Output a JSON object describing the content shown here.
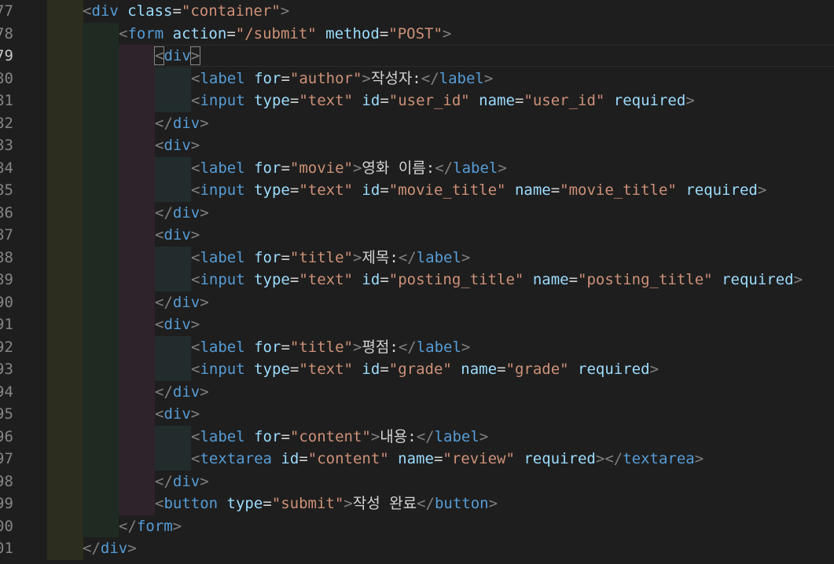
{
  "editor": {
    "language": "html",
    "active_line": "79",
    "colors": {
      "background": "#1e1e1e",
      "tag": "#569cd6",
      "attribute": "#9cdcfe",
      "string": "#ce9178",
      "text": "#d4d4d4",
      "punctuation": "#808080",
      "line_number": "#858585"
    },
    "lines": [
      {
        "num": "77",
        "indent": 0,
        "tokens": [
          [
            "p",
            "<"
          ],
          [
            "tag",
            "div"
          ],
          [
            "t",
            " "
          ],
          [
            "attr",
            "class"
          ],
          [
            "eq",
            "="
          ],
          [
            "str",
            "\"container\""
          ],
          [
            "p",
            ">"
          ]
        ]
      },
      {
        "num": "78",
        "indent": 1,
        "tokens": [
          [
            "p",
            "<"
          ],
          [
            "tag",
            "form"
          ],
          [
            "t",
            " "
          ],
          [
            "attr",
            "action"
          ],
          [
            "eq",
            "="
          ],
          [
            "str",
            "\"/submit\""
          ],
          [
            "t",
            " "
          ],
          [
            "attr",
            "method"
          ],
          [
            "eq",
            "="
          ],
          [
            "str",
            "\"POST\""
          ],
          [
            "p",
            ">"
          ]
        ]
      },
      {
        "num": "79",
        "indent": 2,
        "tokens": [
          [
            "pb",
            "<"
          ],
          [
            "tag",
            "div"
          ],
          [
            "pb",
            ">"
          ]
        ]
      },
      {
        "num": "80",
        "indent": 3,
        "tokens": [
          [
            "p",
            "<"
          ],
          [
            "tag",
            "label"
          ],
          [
            "t",
            " "
          ],
          [
            "attr",
            "for"
          ],
          [
            "eq",
            "="
          ],
          [
            "str",
            "\"author\""
          ],
          [
            "p",
            ">"
          ],
          [
            "t",
            "작성자:"
          ],
          [
            "p",
            "</"
          ],
          [
            "tag",
            "label"
          ],
          [
            "p",
            ">"
          ]
        ]
      },
      {
        "num": "81",
        "indent": 3,
        "tokens": [
          [
            "p",
            "<"
          ],
          [
            "tag",
            "input"
          ],
          [
            "t",
            " "
          ],
          [
            "attr",
            "type"
          ],
          [
            "eq",
            "="
          ],
          [
            "str",
            "\"text\""
          ],
          [
            "t",
            " "
          ],
          [
            "attr",
            "id"
          ],
          [
            "eq",
            "="
          ],
          [
            "str",
            "\"user_id\""
          ],
          [
            "t",
            " "
          ],
          [
            "attr",
            "name"
          ],
          [
            "eq",
            "="
          ],
          [
            "str",
            "\"user_id\""
          ],
          [
            "t",
            " "
          ],
          [
            "attr",
            "required"
          ],
          [
            "p",
            ">"
          ]
        ]
      },
      {
        "num": "82",
        "indent": 2,
        "tokens": [
          [
            "p",
            "</"
          ],
          [
            "tag",
            "div"
          ],
          [
            "p",
            ">"
          ]
        ]
      },
      {
        "num": "83",
        "indent": 2,
        "tokens": [
          [
            "p",
            "<"
          ],
          [
            "tag",
            "div"
          ],
          [
            "p",
            ">"
          ]
        ]
      },
      {
        "num": "84",
        "indent": 3,
        "tokens": [
          [
            "p",
            "<"
          ],
          [
            "tag",
            "label"
          ],
          [
            "t",
            " "
          ],
          [
            "attr",
            "for"
          ],
          [
            "eq",
            "="
          ],
          [
            "str",
            "\"movie\""
          ],
          [
            "p",
            ">"
          ],
          [
            "t",
            "영화 이름:"
          ],
          [
            "p",
            "</"
          ],
          [
            "tag",
            "label"
          ],
          [
            "p",
            ">"
          ]
        ]
      },
      {
        "num": "85",
        "indent": 3,
        "tokens": [
          [
            "p",
            "<"
          ],
          [
            "tag",
            "input"
          ],
          [
            "t",
            " "
          ],
          [
            "attr",
            "type"
          ],
          [
            "eq",
            "="
          ],
          [
            "str",
            "\"text\""
          ],
          [
            "t",
            " "
          ],
          [
            "attr",
            "id"
          ],
          [
            "eq",
            "="
          ],
          [
            "str",
            "\"movie_title\""
          ],
          [
            "t",
            " "
          ],
          [
            "attr",
            "name"
          ],
          [
            "eq",
            "="
          ],
          [
            "str",
            "\"movie_title\""
          ],
          [
            "t",
            " "
          ],
          [
            "attr",
            "required"
          ],
          [
            "p",
            ">"
          ]
        ]
      },
      {
        "num": "86",
        "indent": 2,
        "tokens": [
          [
            "p",
            "</"
          ],
          [
            "tag",
            "div"
          ],
          [
            "p",
            ">"
          ]
        ]
      },
      {
        "num": "87",
        "indent": 2,
        "tokens": [
          [
            "p",
            "<"
          ],
          [
            "tag",
            "div"
          ],
          [
            "p",
            ">"
          ]
        ]
      },
      {
        "num": "88",
        "indent": 3,
        "tokens": [
          [
            "p",
            "<"
          ],
          [
            "tag",
            "label"
          ],
          [
            "t",
            " "
          ],
          [
            "attr",
            "for"
          ],
          [
            "eq",
            "="
          ],
          [
            "str",
            "\"title\""
          ],
          [
            "p",
            ">"
          ],
          [
            "t",
            "제목:"
          ],
          [
            "p",
            "</"
          ],
          [
            "tag",
            "label"
          ],
          [
            "p",
            ">"
          ]
        ]
      },
      {
        "num": "89",
        "indent": 3,
        "tokens": [
          [
            "p",
            "<"
          ],
          [
            "tag",
            "input"
          ],
          [
            "t",
            " "
          ],
          [
            "attr",
            "type"
          ],
          [
            "eq",
            "="
          ],
          [
            "str",
            "\"text\""
          ],
          [
            "t",
            " "
          ],
          [
            "attr",
            "id"
          ],
          [
            "eq",
            "="
          ],
          [
            "str",
            "\"posting_title\""
          ],
          [
            "t",
            " "
          ],
          [
            "attr",
            "name"
          ],
          [
            "eq",
            "="
          ],
          [
            "str",
            "\"posting_title\""
          ],
          [
            "t",
            " "
          ],
          [
            "attr",
            "required"
          ],
          [
            "p",
            ">"
          ]
        ]
      },
      {
        "num": "90",
        "indent": 2,
        "tokens": [
          [
            "p",
            "</"
          ],
          [
            "tag",
            "div"
          ],
          [
            "p",
            ">"
          ]
        ]
      },
      {
        "num": "91",
        "indent": 2,
        "tokens": [
          [
            "p",
            "<"
          ],
          [
            "tag",
            "div"
          ],
          [
            "p",
            ">"
          ]
        ]
      },
      {
        "num": "92",
        "indent": 3,
        "tokens": [
          [
            "p",
            "<"
          ],
          [
            "tag",
            "label"
          ],
          [
            "t",
            " "
          ],
          [
            "attr",
            "for"
          ],
          [
            "eq",
            "="
          ],
          [
            "str",
            "\"title\""
          ],
          [
            "p",
            ">"
          ],
          [
            "t",
            "평점:"
          ],
          [
            "p",
            "</"
          ],
          [
            "tag",
            "label"
          ],
          [
            "p",
            ">"
          ]
        ]
      },
      {
        "num": "93",
        "indent": 3,
        "tokens": [
          [
            "p",
            "<"
          ],
          [
            "tag",
            "input"
          ],
          [
            "t",
            " "
          ],
          [
            "attr",
            "type"
          ],
          [
            "eq",
            "="
          ],
          [
            "str",
            "\"text\""
          ],
          [
            "t",
            " "
          ],
          [
            "attr",
            "id"
          ],
          [
            "eq",
            "="
          ],
          [
            "str",
            "\"grade\""
          ],
          [
            "t",
            " "
          ],
          [
            "attr",
            "name"
          ],
          [
            "eq",
            "="
          ],
          [
            "str",
            "\"grade\""
          ],
          [
            "t",
            " "
          ],
          [
            "attr",
            "required"
          ],
          [
            "p",
            ">"
          ]
        ]
      },
      {
        "num": "94",
        "indent": 2,
        "tokens": [
          [
            "p",
            "</"
          ],
          [
            "tag",
            "div"
          ],
          [
            "p",
            ">"
          ]
        ]
      },
      {
        "num": "95",
        "indent": 2,
        "tokens": [
          [
            "p",
            "<"
          ],
          [
            "tag",
            "div"
          ],
          [
            "p",
            ">"
          ]
        ]
      },
      {
        "num": "96",
        "indent": 3,
        "tokens": [
          [
            "p",
            "<"
          ],
          [
            "tag",
            "label"
          ],
          [
            "t",
            " "
          ],
          [
            "attr",
            "for"
          ],
          [
            "eq",
            "="
          ],
          [
            "str",
            "\"content\""
          ],
          [
            "p",
            ">"
          ],
          [
            "t",
            "내용:"
          ],
          [
            "p",
            "</"
          ],
          [
            "tag",
            "label"
          ],
          [
            "p",
            ">"
          ]
        ]
      },
      {
        "num": "97",
        "indent": 3,
        "tokens": [
          [
            "p",
            "<"
          ],
          [
            "tag",
            "textarea"
          ],
          [
            "t",
            " "
          ],
          [
            "attr",
            "id"
          ],
          [
            "eq",
            "="
          ],
          [
            "str",
            "\"content\""
          ],
          [
            "t",
            " "
          ],
          [
            "attr",
            "name"
          ],
          [
            "eq",
            "="
          ],
          [
            "str",
            "\"review\""
          ],
          [
            "t",
            " "
          ],
          [
            "attr",
            "required"
          ],
          [
            "p",
            "></"
          ],
          [
            "tag",
            "textarea"
          ],
          [
            "p",
            ">"
          ]
        ]
      },
      {
        "num": "98",
        "indent": 2,
        "tokens": [
          [
            "p",
            "</"
          ],
          [
            "tag",
            "div"
          ],
          [
            "p",
            ">"
          ]
        ]
      },
      {
        "num": "99",
        "indent": 2,
        "tokens": [
          [
            "p",
            "<"
          ],
          [
            "tag",
            "button"
          ],
          [
            "t",
            " "
          ],
          [
            "attr",
            "type"
          ],
          [
            "eq",
            "="
          ],
          [
            "str",
            "\"submit\""
          ],
          [
            "p",
            ">"
          ],
          [
            "t",
            "작성 완료"
          ],
          [
            "p",
            "</"
          ],
          [
            "tag",
            "button"
          ],
          [
            "p",
            ">"
          ]
        ]
      },
      {
        "num": "00",
        "indent": 1,
        "tokens": [
          [
            "p",
            "</"
          ],
          [
            "tag",
            "form"
          ],
          [
            "p",
            ">"
          ]
        ]
      },
      {
        "num": "01",
        "indent": 0,
        "tokens": [
          [
            "p",
            "</"
          ],
          [
            "tag",
            "div"
          ],
          [
            "p",
            ">"
          ]
        ]
      }
    ]
  }
}
